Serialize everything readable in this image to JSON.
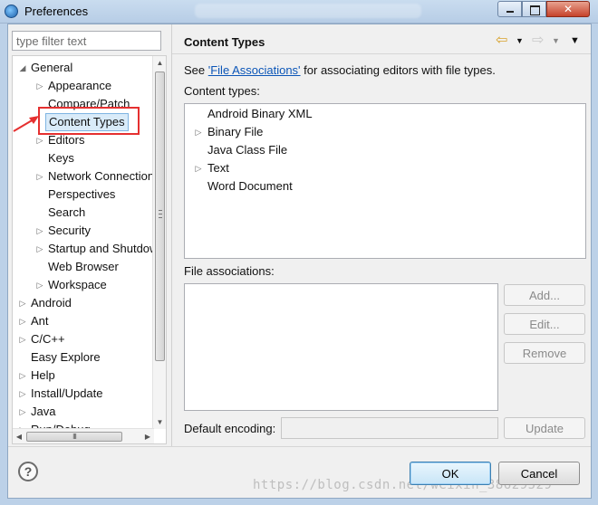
{
  "window": {
    "title": "Preferences",
    "controls": [
      "minimize",
      "maximize",
      "close"
    ]
  },
  "left": {
    "filter_placeholder": "type filter text",
    "tree": [
      {
        "label": "General",
        "depth": 0,
        "twisty": "expanded"
      },
      {
        "label": "Appearance",
        "depth": 1,
        "twisty": "collapsed"
      },
      {
        "label": "Compare/Patch",
        "depth": 1,
        "twisty": "none"
      },
      {
        "label": "Content Types",
        "depth": 1,
        "twisty": "none",
        "selected": true
      },
      {
        "label": "Editors",
        "depth": 1,
        "twisty": "collapsed"
      },
      {
        "label": "Keys",
        "depth": 1,
        "twisty": "none"
      },
      {
        "label": "Network Connections",
        "depth": 1,
        "twisty": "collapsed"
      },
      {
        "label": "Perspectives",
        "depth": 1,
        "twisty": "none"
      },
      {
        "label": "Search",
        "depth": 1,
        "twisty": "none"
      },
      {
        "label": "Security",
        "depth": 1,
        "twisty": "collapsed"
      },
      {
        "label": "Startup and Shutdown",
        "depth": 1,
        "twisty": "collapsed"
      },
      {
        "label": "Web Browser",
        "depth": 1,
        "twisty": "none"
      },
      {
        "label": "Workspace",
        "depth": 1,
        "twisty": "collapsed"
      },
      {
        "label": "Android",
        "depth": 0,
        "twisty": "collapsed"
      },
      {
        "label": "Ant",
        "depth": 0,
        "twisty": "collapsed"
      },
      {
        "label": "C/C++",
        "depth": 0,
        "twisty": "collapsed"
      },
      {
        "label": "Easy Explore",
        "depth": 0,
        "twisty": "none"
      },
      {
        "label": "Help",
        "depth": 0,
        "twisty": "collapsed"
      },
      {
        "label": "Install/Update",
        "depth": 0,
        "twisty": "collapsed"
      },
      {
        "label": "Java",
        "depth": 0,
        "twisty": "collapsed"
      },
      {
        "label": "Run/Debug",
        "depth": 0,
        "twisty": "collapsed"
      }
    ],
    "hscroll_grip": "III"
  },
  "page": {
    "title": "Content Types",
    "see_prefix": "See ",
    "see_link": "'File Associations'",
    "see_suffix": " for associating editors with file types.",
    "content_types_label": "Content types:",
    "content_types": [
      {
        "label": "Android Binary XML",
        "twisty": "none"
      },
      {
        "label": "Binary File",
        "twisty": "collapsed"
      },
      {
        "label": "Java Class File",
        "twisty": "none"
      },
      {
        "label": "Text",
        "twisty": "collapsed"
      },
      {
        "label": "Word Document",
        "twisty": "none"
      }
    ],
    "file_assoc_label": "File associations:",
    "buttons": {
      "add": "Add...",
      "edit": "Edit...",
      "remove": "Remove",
      "update": "Update"
    },
    "encoding_label": "Default encoding:"
  },
  "footer": {
    "help": "?",
    "ok": "OK",
    "cancel": "Cancel",
    "watermark": "https://blog.csdn.net/weixin_38629529"
  },
  "colors": {
    "selection_bg": "#d9ebf9",
    "annotation_red": "#e53030",
    "link": "#0b55b7"
  }
}
